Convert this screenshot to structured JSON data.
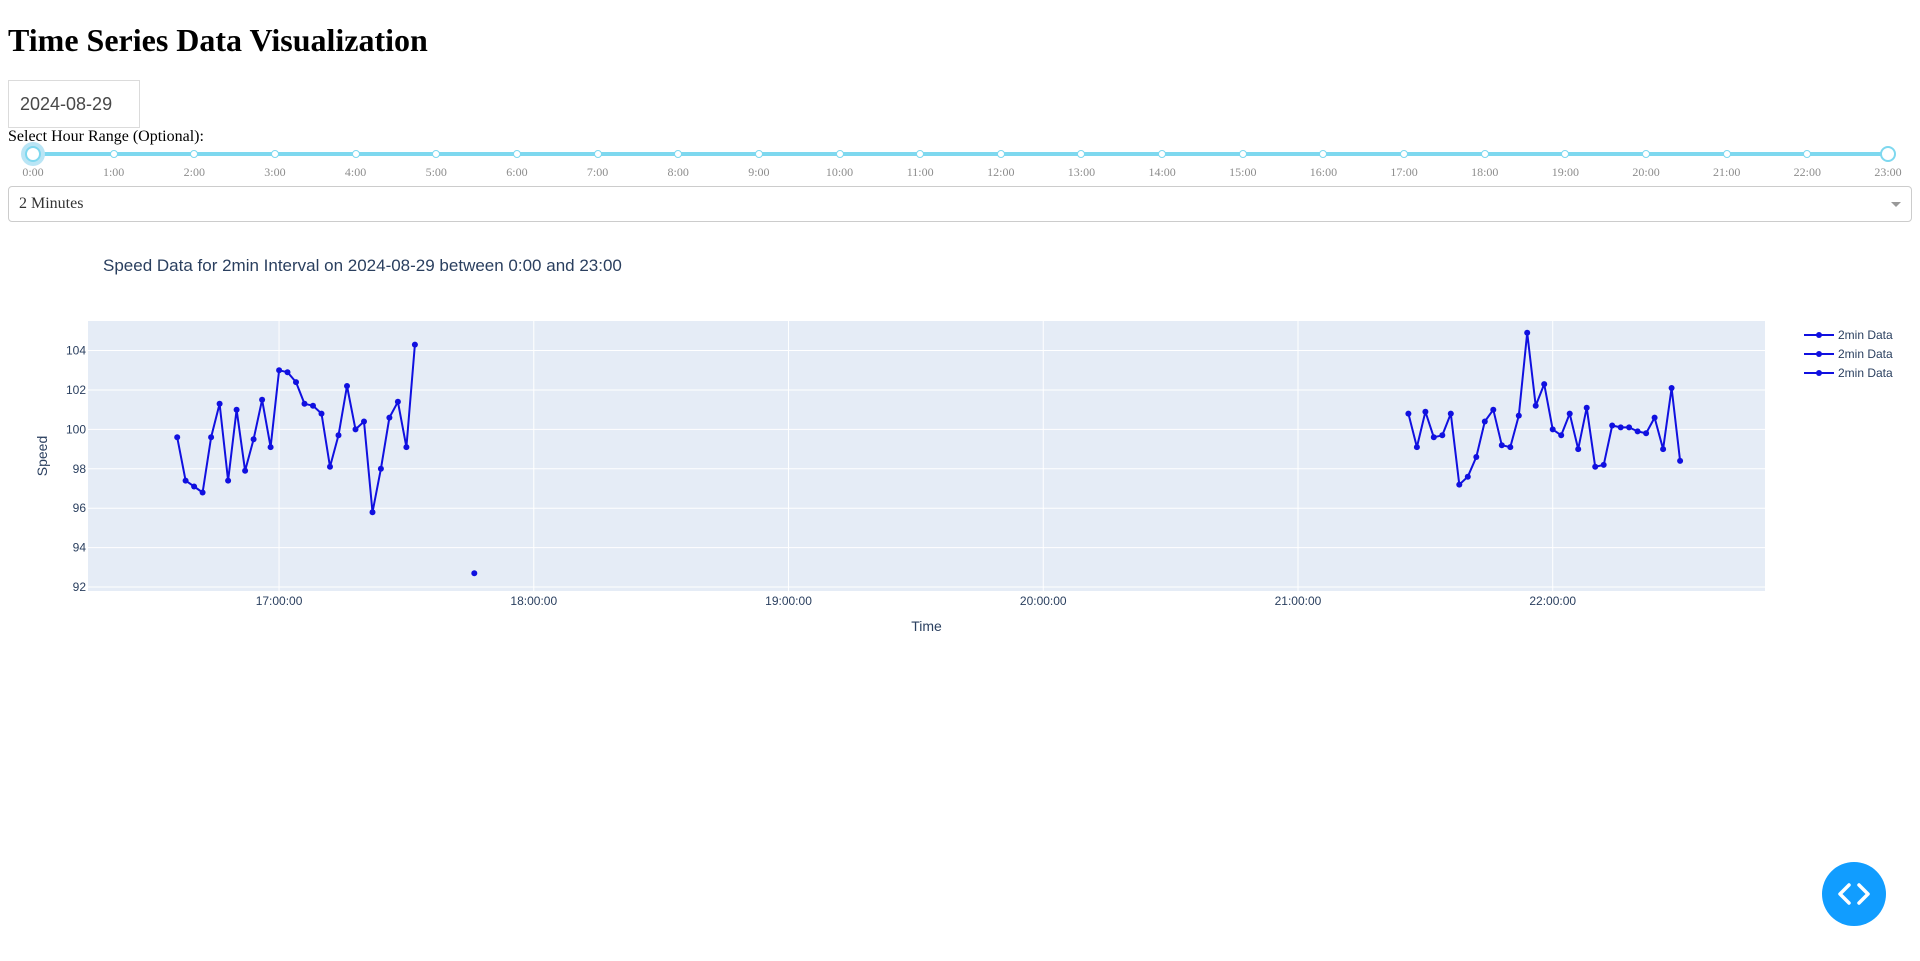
{
  "page": {
    "title": "Time Series Data Visualization"
  },
  "date_picker": {
    "value": "2024-08-29"
  },
  "hour_range": {
    "label": "Select Hour Range (Optional):",
    "min": 0,
    "max": 23,
    "value": [
      0,
      23
    ],
    "marks": [
      "0:00",
      "1:00",
      "2:00",
      "3:00",
      "4:00",
      "5:00",
      "6:00",
      "7:00",
      "8:00",
      "9:00",
      "10:00",
      "11:00",
      "12:00",
      "13:00",
      "14:00",
      "15:00",
      "16:00",
      "17:00",
      "18:00",
      "19:00",
      "20:00",
      "21:00",
      "22:00",
      "23:00"
    ]
  },
  "interval_select": {
    "value": "2 Minutes"
  },
  "colors": {
    "line": "#1010e0",
    "plot_bg": "#e5ecf6",
    "slider": "#7ed8ef",
    "fab": "#119dff",
    "text": "#2a3f5f"
  },
  "fab": {
    "icon": "code-icon"
  },
  "chart_data": {
    "type": "line",
    "title": "Speed Data for 2min Interval on 2024-08-29 between 0:00 and 23:00",
    "xlabel": "Time",
    "ylabel": "Speed",
    "x_range": [
      "16:15",
      "22:50"
    ],
    "y_range": [
      91.8,
      105.5
    ],
    "y_ticks": [
      92,
      94,
      96,
      98,
      100,
      102,
      104
    ],
    "x_ticks": [
      "17:00:00",
      "18:00:00",
      "19:00:00",
      "20:00:00",
      "21:00:00",
      "22:00:00"
    ],
    "grid": true,
    "legend_position": "top-right",
    "series": [
      {
        "name": "2min Data",
        "x": [
          "16:36",
          "16:38",
          "16:40",
          "16:42",
          "16:44",
          "16:46",
          "16:48",
          "16:50",
          "16:52",
          "16:54",
          "16:56",
          "16:58",
          "17:00",
          "17:02",
          "17:04",
          "17:06",
          "17:08",
          "17:10",
          "17:12",
          "17:14",
          "17:16",
          "17:18",
          "17:20",
          "17:22",
          "17:24",
          "17:26",
          "17:28",
          "17:30",
          "17:32"
        ],
        "y": [
          99.6,
          97.4,
          97.1,
          96.8,
          99.6,
          101.3,
          97.4,
          101.0,
          97.9,
          99.5,
          101.5,
          99.1,
          103.0,
          102.9,
          102.4,
          101.3,
          101.2,
          100.8,
          98.1,
          99.7,
          102.2,
          100.0,
          100.4,
          95.8,
          98.0,
          100.6,
          101.4,
          99.1,
          104.3
        ]
      },
      {
        "name": "2min Data",
        "x": [
          "17:46"
        ],
        "y": [
          92.7
        ]
      },
      {
        "name": "2min Data",
        "x": [
          "21:26",
          "21:28",
          "21:30",
          "21:32",
          "21:34",
          "21:36",
          "21:38",
          "21:40",
          "21:42",
          "21:44",
          "21:46",
          "21:48",
          "21:50",
          "21:52",
          "21:54",
          "21:56",
          "21:58",
          "22:00",
          "22:02",
          "22:04",
          "22:06",
          "22:08",
          "22:10",
          "22:12",
          "22:14",
          "22:16",
          "22:18",
          "22:20",
          "22:22",
          "22:24",
          "22:26",
          "22:28",
          "22:30"
        ],
        "y": [
          100.8,
          99.1,
          100.9,
          99.6,
          99.7,
          100.8,
          97.2,
          97.6,
          98.6,
          100.4,
          101.0,
          99.2,
          99.1,
          100.7,
          104.9,
          101.2,
          102.3,
          100.0,
          99.7,
          100.8,
          99.0,
          101.1,
          98.1,
          98.2,
          100.2,
          100.1,
          100.1,
          99.9,
          99.8,
          100.6,
          99.0,
          102.1,
          98.4
        ]
      }
    ]
  }
}
